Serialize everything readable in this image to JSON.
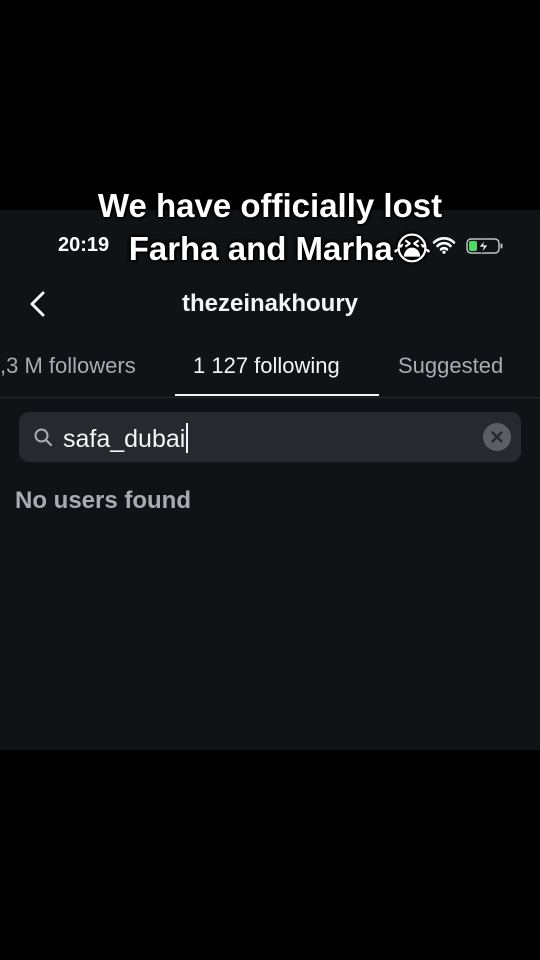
{
  "caption": {
    "line1": "We have officially lost",
    "line2": "Farha and Marha😭"
  },
  "status_bar": {
    "time": "20:19",
    "icons": [
      "wifi-icon",
      "battery-charging-icon"
    ]
  },
  "header": {
    "back_icon": "chevron-left-icon",
    "title": "thezeinakhoury"
  },
  "tabs": [
    {
      "label": ",3 M followers",
      "active": false
    },
    {
      "label": "1 127 following",
      "active": true
    },
    {
      "label": "Suggested",
      "active": false
    }
  ],
  "search": {
    "icon": "search-icon",
    "value": "safa_dubai",
    "clear_icon": "clear-icon"
  },
  "results": {
    "empty_message": "No users found"
  },
  "colors": {
    "page_background": "#000000",
    "screen_background": "#0f1316",
    "search_background": "#26292d",
    "primary_text": "#f3f5f7",
    "secondary_text": "#a8acb0",
    "battery_green": "#4cd964"
  }
}
